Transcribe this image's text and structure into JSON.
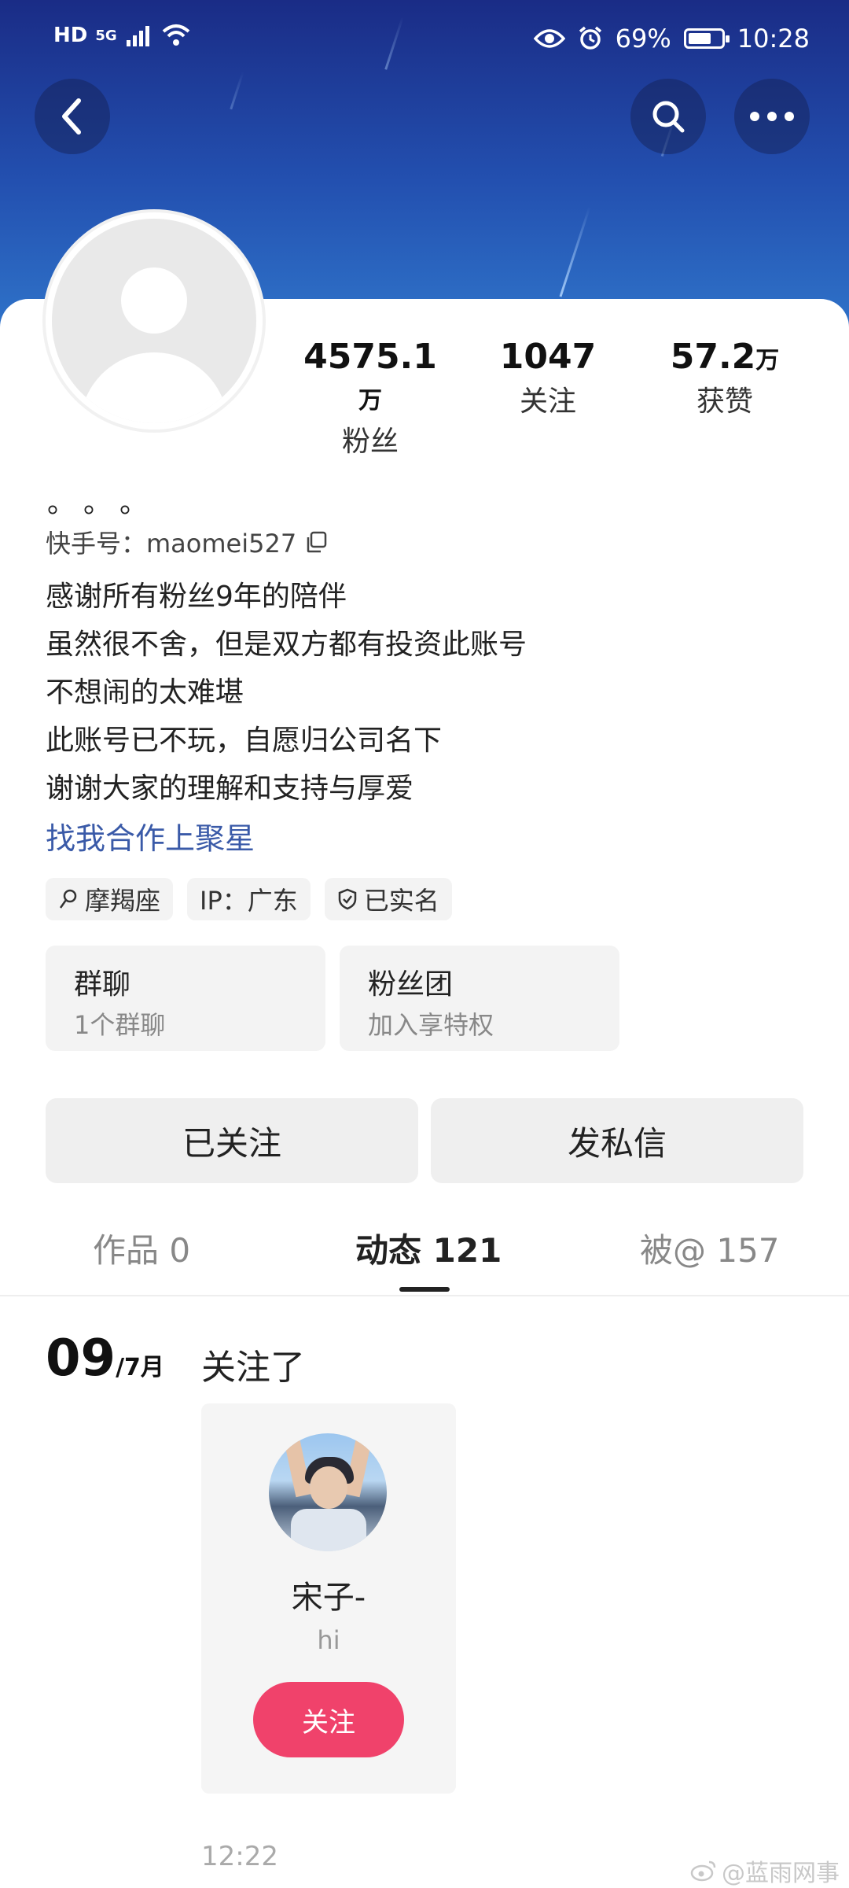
{
  "status_bar": {
    "left_labels": [
      "HD",
      "5G"
    ],
    "battery_percent": "69%",
    "time": "10:28",
    "battery_level": 0.69
  },
  "profile": {
    "display_name": "。。。",
    "kuaishou_id": "快手号：maomei527",
    "stats": [
      {
        "value": "4575.1",
        "unit": "万",
        "label": "粉丝"
      },
      {
        "value": "1047",
        "unit": "",
        "label": "关注"
      },
      {
        "value": "57.2",
        "unit": "万",
        "label": "获赞"
      }
    ],
    "bio_lines": [
      "感谢所有粉丝9年的陪伴",
      "虽然很不舍，但是双方都有投资此账号",
      "不想闹的太难堪",
      "此账号已不玩，自愿归公司名下",
      "谢谢大家的理解和支持与厚爱"
    ],
    "link_text": "找我合作上聚星",
    "tags": [
      "摩羯座",
      "IP：广东",
      "已实名"
    ]
  },
  "tiles": [
    {
      "title": "群聊",
      "subtitle": "1个群聊"
    },
    {
      "title": "粉丝团",
      "subtitle": "加入享特权"
    }
  ],
  "actions": {
    "followed": "已关注",
    "message": "发私信"
  },
  "tabs": [
    {
      "label": "作品 0",
      "active": false
    },
    {
      "label": "动态 121",
      "active": true
    },
    {
      "label": "被@ 157",
      "active": false
    }
  ],
  "feed": {
    "day": "09",
    "month": "/7月",
    "title": "关注了",
    "user_name": "宋子-",
    "user_sub": "hi",
    "follow_btn": "关注",
    "time": "12:22"
  },
  "watermark": "@蓝雨网事",
  "colors": {
    "accent_pink": "#f0426b",
    "link_blue": "#3a5aa8",
    "header_blue": "#2350b0"
  }
}
